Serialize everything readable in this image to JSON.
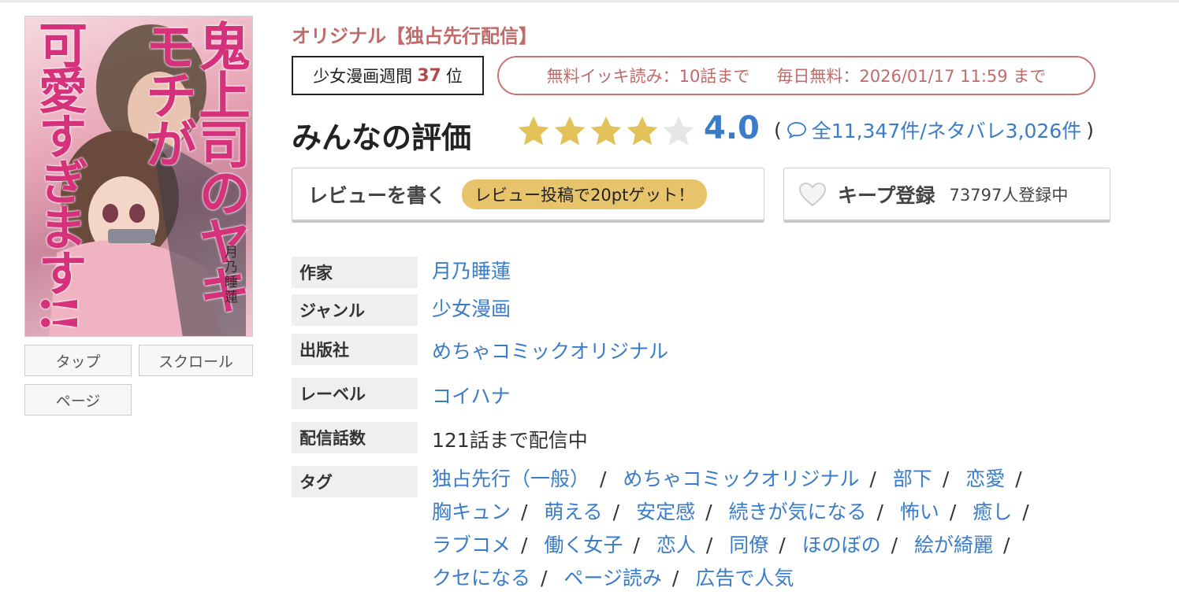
{
  "cover": {
    "title_main": "鬼上司のヤキモチが",
    "title_sub": "可愛すぎます!!",
    "author": "月乃睡蓮"
  },
  "view_buttons": {
    "tap": "タップ",
    "scroll": "スクロール",
    "page": "ページ"
  },
  "badge": "オリジナル【独占先行配信】",
  "ranking": {
    "prefix": "少女漫画週間",
    "rank": "37",
    "suffix": "位"
  },
  "free_info": {
    "ikki": "無料イッキ読み：10話まで",
    "daily": "毎日無料：2026/01/17 11:59 まで"
  },
  "rating": {
    "title": "みんなの評価",
    "value": "4.0",
    "stars": 4,
    "max_stars": 5,
    "open_paren": "(",
    "count_text": "全11,347件/ネタバレ3,026件",
    "close_paren": ")"
  },
  "review_button": {
    "label": "レビューを書く",
    "promo": "レビュー投稿で20ptゲット！"
  },
  "keep_button": {
    "label": "キープ登録",
    "count": "73797人登録中"
  },
  "details": {
    "author_label": "作家",
    "author": "月乃睡蓮",
    "genre_label": "ジャンル",
    "genre": "少女漫画",
    "publisher_label": "出版社",
    "publisher": "めちゃコミックオリジナル",
    "label_label": "レーベル",
    "label": "コイハナ",
    "episodes_label": "配信話数",
    "episodes": "121話まで配信中",
    "tags_label": "タグ"
  },
  "tags": [
    "独占先行（一般）",
    "めちゃコミックオリジナル",
    "部下",
    "恋愛",
    "胸キュン",
    "萌える",
    "安定感",
    "続きが気になる",
    "怖い",
    "癒し",
    "ラブコメ",
    "働く女子",
    "恋人",
    "同僚",
    "ほのぼの",
    "絵が綺麗",
    "クセになる",
    "ページ読み",
    "広告で人気"
  ],
  "tag_separator": "/",
  "colors": {
    "link": "#3a7cc7",
    "accent": "#c06a6a",
    "star": "#e3c25a",
    "star_empty": "#e6e6e6"
  }
}
